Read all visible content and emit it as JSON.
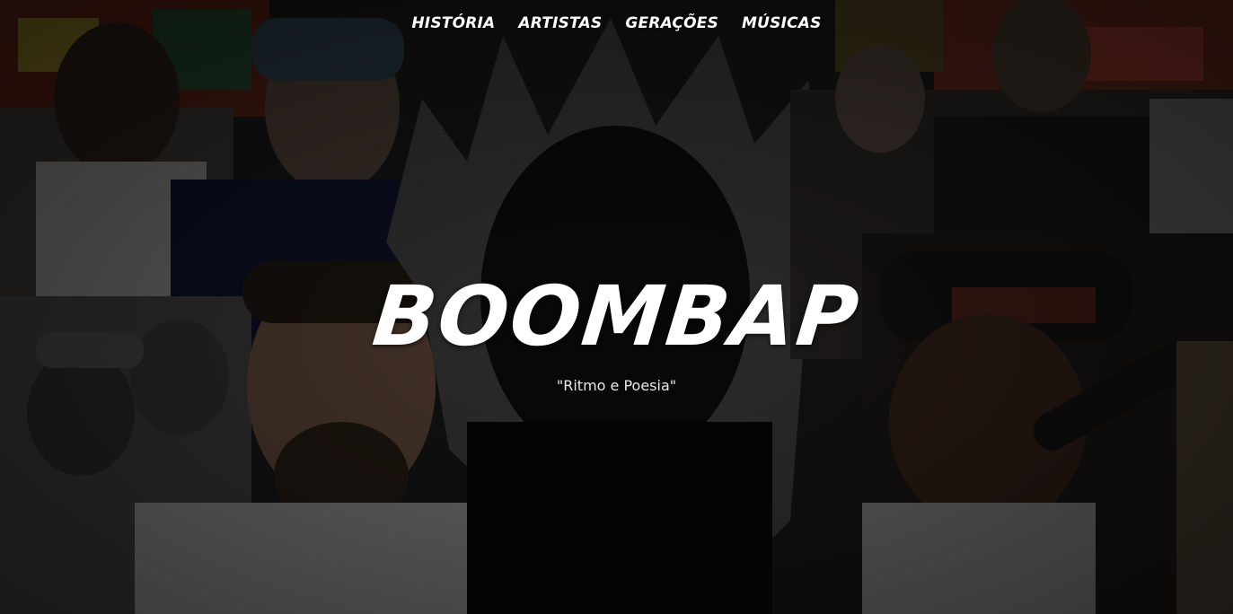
{
  "nav": {
    "items": [
      {
        "label": "HISTÓRIA"
      },
      {
        "label": "ARTISTAS"
      },
      {
        "label": "GERAÇÕES"
      },
      {
        "label": "MÚSICAS"
      }
    ]
  },
  "hero": {
    "title": "BOOMBAP",
    "subtitle": "\"Ritmo e Poesia\""
  },
  "colors": {
    "text": "#ffffff",
    "overlay": "#000000"
  }
}
